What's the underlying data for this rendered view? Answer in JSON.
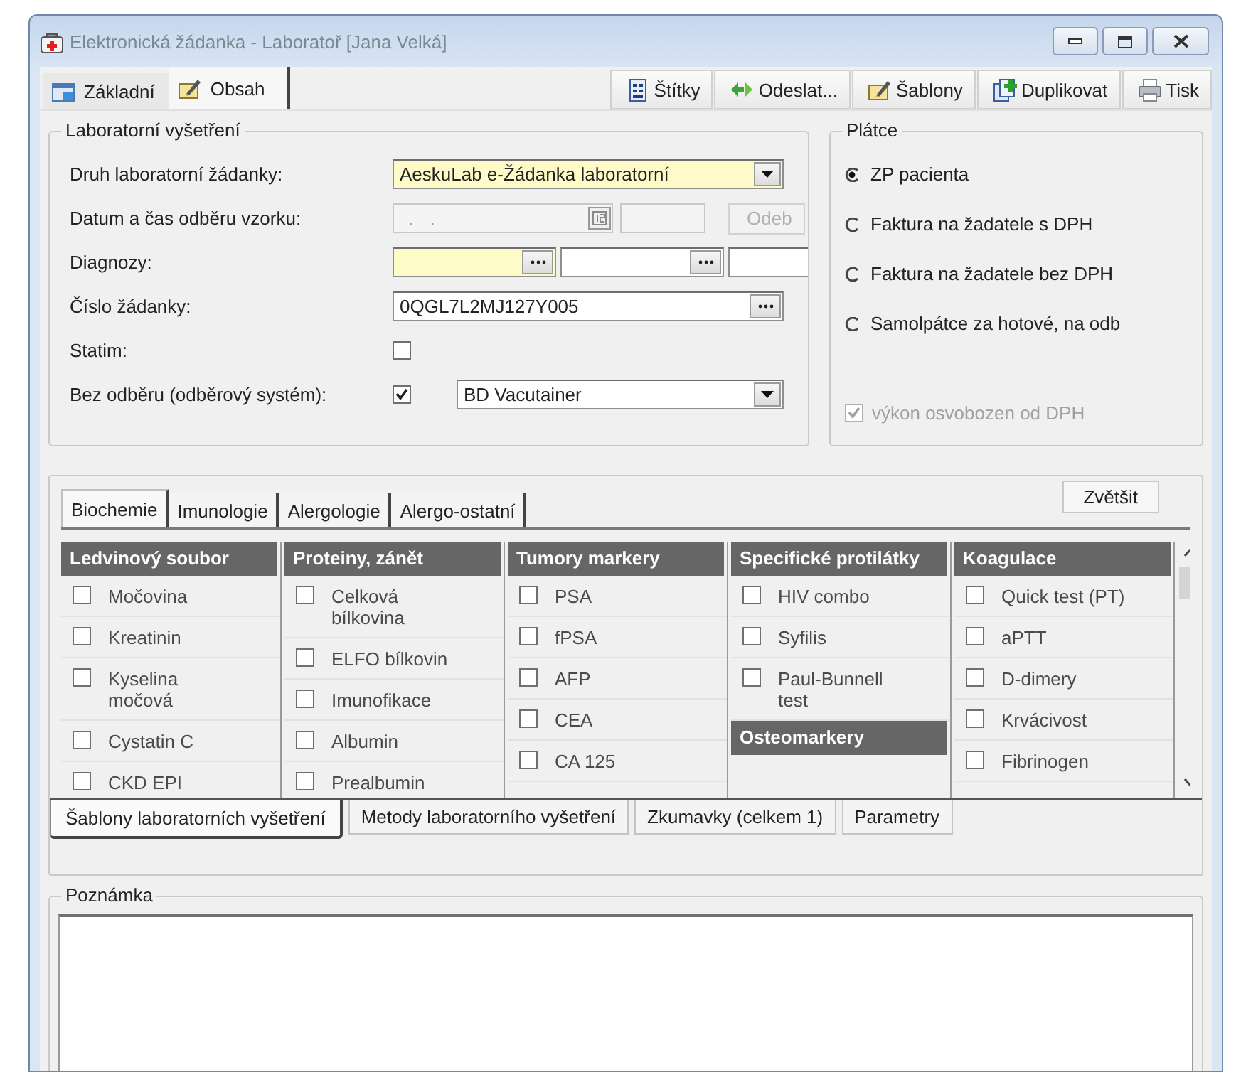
{
  "window": {
    "title": "Elektronická žádanka - Laboratoř [Jana Velká]"
  },
  "tabs": [
    {
      "label": "Základní",
      "selected": false
    },
    {
      "label": "Obsah",
      "selected": true
    }
  ],
  "toolbar": [
    {
      "label": "Štítky"
    },
    {
      "label": "Odeslat..."
    },
    {
      "label": "Šablony"
    },
    {
      "label": "Duplikovat"
    },
    {
      "label": "Tisk"
    }
  ],
  "lab_exam": {
    "title": "Laboratorní vyšetření",
    "fields": [
      {
        "kind": "combo",
        "label": "Druh laboratorní žádanky:",
        "value": "AeskuLab e-Žádanka laboratorní",
        "required": true
      },
      {
        "kind": "datetime",
        "label": "Datum a čas odběru vzorku:",
        "placeholder": ". .",
        "button": "Odeb",
        "disabled": true
      },
      {
        "kind": "multi",
        "label": "Diagnozy:",
        "inputs": [
          {
            "required": true
          },
          {
            "required": false
          },
          {
            "required": false
          }
        ]
      },
      {
        "kind": "lookup",
        "label": "Číslo žádanky:",
        "value": "0QGL7L2MJ127Y005"
      },
      {
        "kind": "check",
        "label": "Statim:",
        "checked": false
      },
      {
        "kind": "check_combo",
        "label": "Bez odběru (odběrový systém):",
        "checked": true,
        "value": "BD Vacutainer"
      }
    ]
  },
  "payer": {
    "title": "Plátce",
    "options": [
      {
        "label": "ZP pacienta",
        "selected": true
      },
      {
        "label": "Faktura na žadatele s DPH",
        "selected": false
      },
      {
        "label": "Faktura na žadatele bez DPH",
        "selected": false
      },
      {
        "label": "Samolpátce za hotové, na odb",
        "selected": false
      }
    ],
    "vat_exempt": {
      "label": "výkon osvobozen od DPH",
      "checked": true,
      "disabled": true
    }
  },
  "exam_tabs": [
    {
      "label": "Biochemie",
      "selected": true
    },
    {
      "label": "Imunologie",
      "selected": false
    },
    {
      "label": "Alergologie",
      "selected": false
    },
    {
      "label": "Alergo-ostatní",
      "selected": false
    }
  ],
  "zoom_button": "Zvětšit",
  "columns": [
    [
      {
        "title": "Ledvinový soubor",
        "items": [
          {
            "label": "Močovina",
            "checked": false
          },
          {
            "label": "Kreatinin",
            "checked": false
          },
          {
            "label": "Kyselina močová",
            "checked": false
          },
          {
            "label": "Cystatin C",
            "checked": false
          },
          {
            "label": "CKD EPI",
            "checked": false
          }
        ]
      }
    ],
    [
      {
        "title": "Proteiny, zánět",
        "items": [
          {
            "label": "Celková bílkovina",
            "checked": false
          },
          {
            "label": "ELFO bílkovin",
            "checked": false
          },
          {
            "label": "Imunofikace",
            "checked": false
          },
          {
            "label": "Albumin",
            "checked": false
          },
          {
            "label": "Prealbumin",
            "checked": false
          }
        ]
      }
    ],
    [
      {
        "title": "Tumory markery",
        "items": [
          {
            "label": "PSA",
            "checked": false
          },
          {
            "label": "fPSA",
            "checked": false
          },
          {
            "label": "AFP",
            "checked": false
          },
          {
            "label": "CEA",
            "checked": false
          },
          {
            "label": "CA 125",
            "checked": false
          }
        ]
      }
    ],
    [
      {
        "title": "Specifické protilátky",
        "items": [
          {
            "label": "HIV combo",
            "checked": false
          },
          {
            "label": "Syfilis",
            "checked": false
          },
          {
            "label": "Paul-Bunnell test",
            "checked": false
          }
        ]
      },
      {
        "title": "Osteomarkery"
      }
    ],
    [
      {
        "title": "Koagulace",
        "items": [
          {
            "label": "Quick test (PT)",
            "checked": false
          },
          {
            "label": "aPTT",
            "checked": false
          },
          {
            "label": "D-dimery",
            "checked": false
          },
          {
            "label": "Krvácivost",
            "checked": false
          },
          {
            "label": "Fibrinogen",
            "checked": false
          }
        ]
      }
    ]
  ],
  "bottom_tabs": [
    {
      "label": "Šablony laboratorních vyšetření",
      "selected": true
    },
    {
      "label": "Metody laboratorního vyšetření",
      "selected": false
    },
    {
      "label": "Zkumavky (celkem 1)",
      "selected": false
    },
    {
      "label": "Parametry",
      "selected": false
    }
  ],
  "note": {
    "title": "Poznámka"
  }
}
